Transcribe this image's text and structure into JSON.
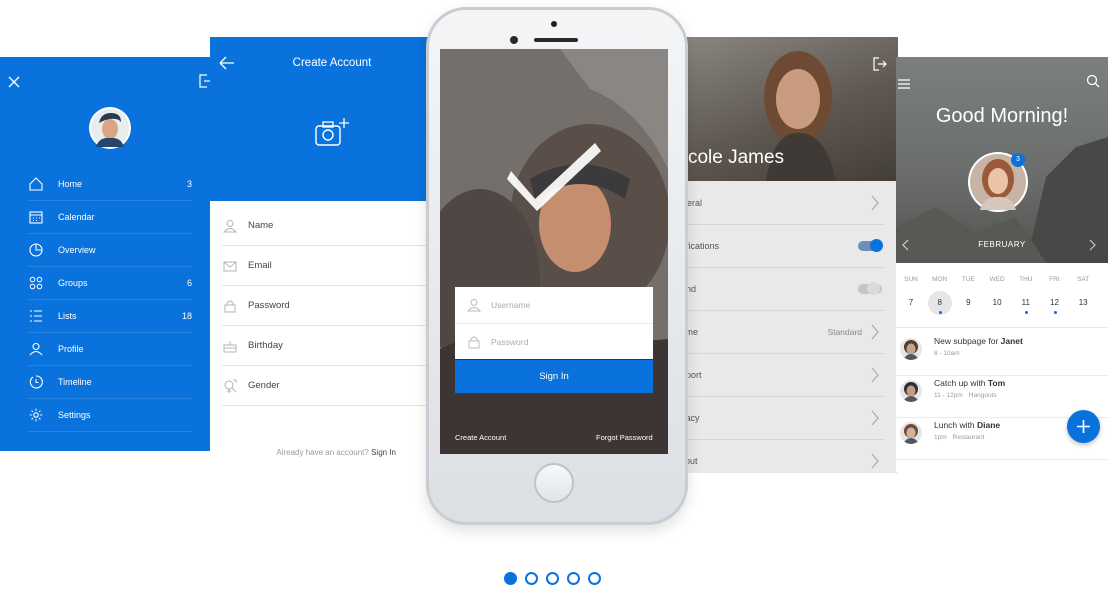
{
  "colors": {
    "accent": "#0a72dc",
    "white": "#ffffff",
    "row_text": "#555555"
  },
  "menu_screen": {
    "icons": {
      "close": "close-icon",
      "logout": "logout-icon"
    },
    "items": [
      {
        "label": "Home",
        "count": "3",
        "icon": "home-icon"
      },
      {
        "label": "Calendar",
        "count": "",
        "icon": "calendar-icon"
      },
      {
        "label": "Overview",
        "count": "",
        "icon": "pie-chart-icon"
      },
      {
        "label": "Groups",
        "count": "6",
        "icon": "groups-icon"
      },
      {
        "label": "Lists",
        "count": "18",
        "icon": "list-icon"
      },
      {
        "label": "Profile",
        "count": "",
        "icon": "person-icon"
      },
      {
        "label": "Timeline",
        "count": "",
        "icon": "clock-icon"
      },
      {
        "label": "Settings",
        "count": "",
        "icon": "gear-icon"
      }
    ]
  },
  "create_account": {
    "title": "Create Account",
    "fields": [
      {
        "label": "Name",
        "icon": "person-icon"
      },
      {
        "label": "Email",
        "icon": "mail-icon"
      },
      {
        "label": "Password",
        "icon": "lock-icon"
      },
      {
        "label": "Birthday",
        "icon": "cake-icon"
      },
      {
        "label": "Gender",
        "icon": "gender-icon"
      }
    ],
    "footer_text": "Already have an account?",
    "footer_link": "Sign In"
  },
  "login": {
    "username_placeholder": "Username",
    "password_placeholder": "Password",
    "sign_in": "Sign In",
    "create_account": "Create Account",
    "forgot_password": "Forgot Password"
  },
  "profile": {
    "name": "Nicole James",
    "rows": [
      {
        "label": "General",
        "value": "",
        "control": "chevron"
      },
      {
        "label": "Notifications",
        "value": "",
        "control": "toggle-on"
      },
      {
        "label": "Sound",
        "value": "",
        "control": "toggle-off"
      },
      {
        "label": "Theme",
        "value": "Standard",
        "control": "chevron"
      },
      {
        "label": "Support",
        "value": "",
        "control": "chevron"
      },
      {
        "label": "Privacy",
        "value": "",
        "control": "chevron"
      },
      {
        "label": "Logout",
        "value": "",
        "control": "chevron"
      }
    ]
  },
  "calendar": {
    "greeting": "Good Morning!",
    "badge": "3",
    "month": "FEBRUARY",
    "weekdays": [
      "SUN",
      "MON",
      "TUE",
      "WED",
      "THU",
      "FRI",
      "SAT"
    ],
    "days": [
      "7",
      "8",
      "9",
      "10",
      "11",
      "12",
      "13"
    ],
    "selected_day": "8",
    "events": [
      {
        "title": "New subpage for ",
        "who": "Janet",
        "time": "8 - 10am",
        "place": ""
      },
      {
        "title": "Catch up with ",
        "who": "Tom",
        "time": "11 - 12pm",
        "place": "Hangouts"
      },
      {
        "title": "Lunch with ",
        "who": "Diane",
        "time": "1pm",
        "place": "Restaurant"
      }
    ]
  },
  "pagination": {
    "total": 5,
    "active": 1
  }
}
